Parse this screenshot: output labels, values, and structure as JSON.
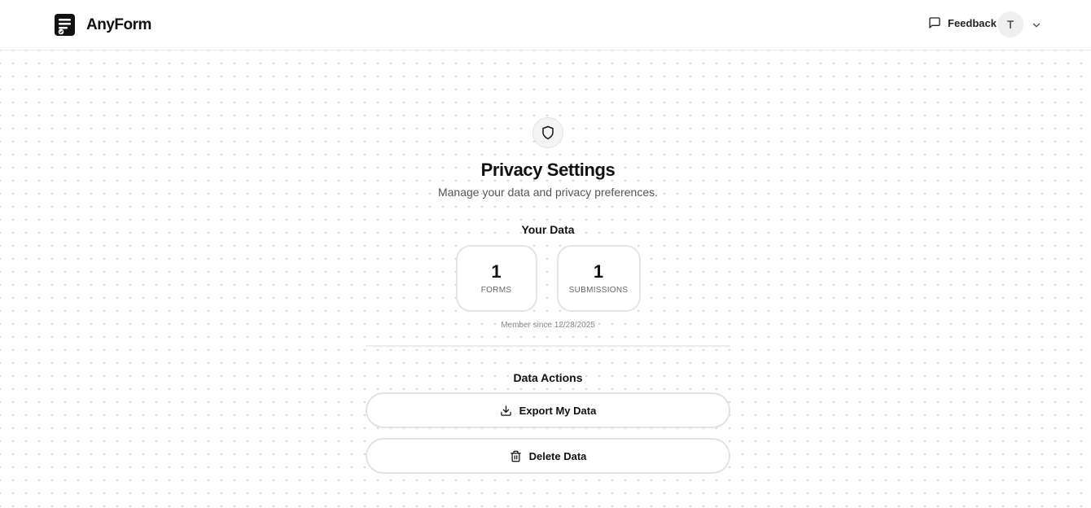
{
  "header": {
    "brand": "AnyForm",
    "feedback_label": "Feedback",
    "avatar_initial": "T"
  },
  "main": {
    "title": "Privacy Settings",
    "subtitle": "Manage your data and privacy preferences.",
    "your_data_heading": "Your Data",
    "stats": [
      {
        "value": "1",
        "label": "FORMS"
      },
      {
        "value": "1",
        "label": "SUBMISSIONS"
      }
    ],
    "member_since": "Member since 12/28/2025",
    "data_actions_heading": "Data Actions",
    "export_label": "Export My Data",
    "delete_label": "Delete Data"
  },
  "icons": {
    "logo": "form-document-icon",
    "feedback": "message-square-icon",
    "account_menu": "chevron-down-icon",
    "privacy": "shield-icon",
    "export": "download-icon",
    "delete": "trash-icon"
  },
  "colors": {
    "background": "#ffffff",
    "dot_grid": "#d4d4d4",
    "border": "#e2e2e2",
    "text": "#111111",
    "muted_text": "#555555"
  }
}
